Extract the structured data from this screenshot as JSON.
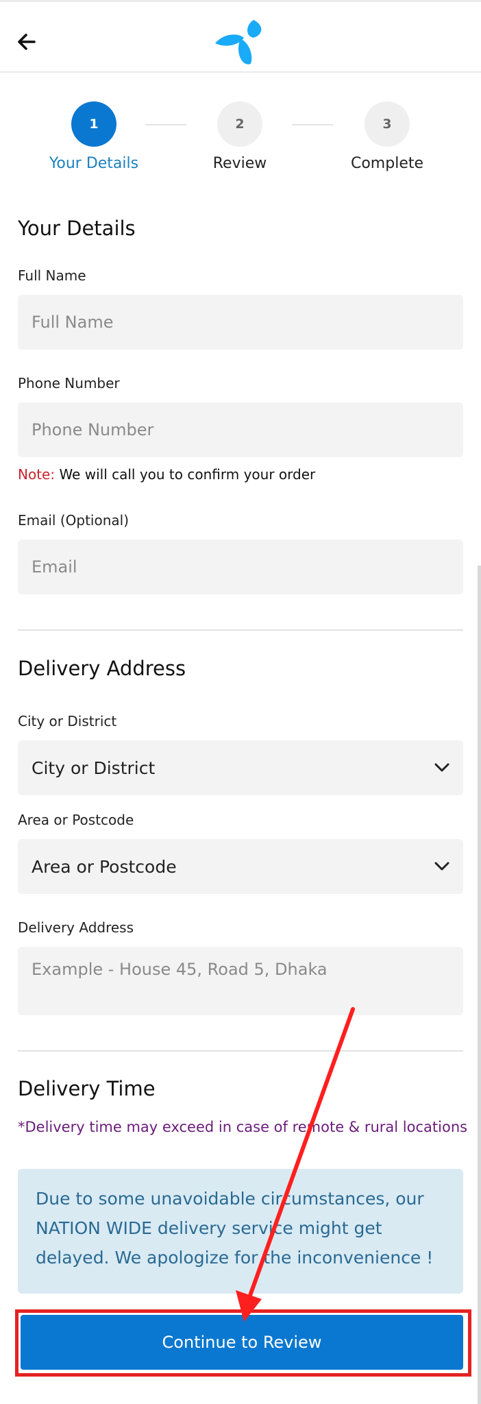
{
  "header": {
    "back_icon": "arrow-left-icon",
    "logo": "telenor-logo",
    "brand_color": "#19AAF8"
  },
  "steps": [
    {
      "number": "1",
      "label": "Your Details",
      "state": "active"
    },
    {
      "number": "2",
      "label": "Review",
      "state": "inactive"
    },
    {
      "number": "3",
      "label": "Complete",
      "state": "inactive"
    }
  ],
  "your_details": {
    "title": "Your Details",
    "full_name": {
      "label": "Full Name",
      "placeholder": "Full Name",
      "value": ""
    },
    "phone": {
      "label": "Phone Number",
      "placeholder": "Phone Number",
      "value": ""
    },
    "note_prefix": "Note:",
    "note_text": " We will call you to confirm your order",
    "email": {
      "label": "Email (Optional)",
      "placeholder": "Email",
      "value": ""
    }
  },
  "delivery_address": {
    "title": "Delivery Address",
    "city": {
      "label": "City or District",
      "selected": "City or District"
    },
    "area": {
      "label": "Area or Postcode",
      "selected": "Area or Postcode"
    },
    "address": {
      "label": "Delivery Address",
      "placeholder": "Example - House 45, Road 5, Dhaka",
      "value": ""
    }
  },
  "delivery_time": {
    "title": "Delivery Time",
    "note": "*Delivery time may exceed in case of remote & rural locations",
    "alert": "Due to some unavoidable circumstances, our NATION WIDE delivery service might get delayed. We apologize for the inconvenience !"
  },
  "actions": {
    "continue_label": "Continue to Review"
  },
  "colors": {
    "primary": "#0A78D0",
    "active_step_label": "#1C82BE",
    "note_red": "#C8232C",
    "delivery_note_purple": "#6A1B7A",
    "alert_bg": "#D9EAF3",
    "annotation_red": "#E52222"
  }
}
